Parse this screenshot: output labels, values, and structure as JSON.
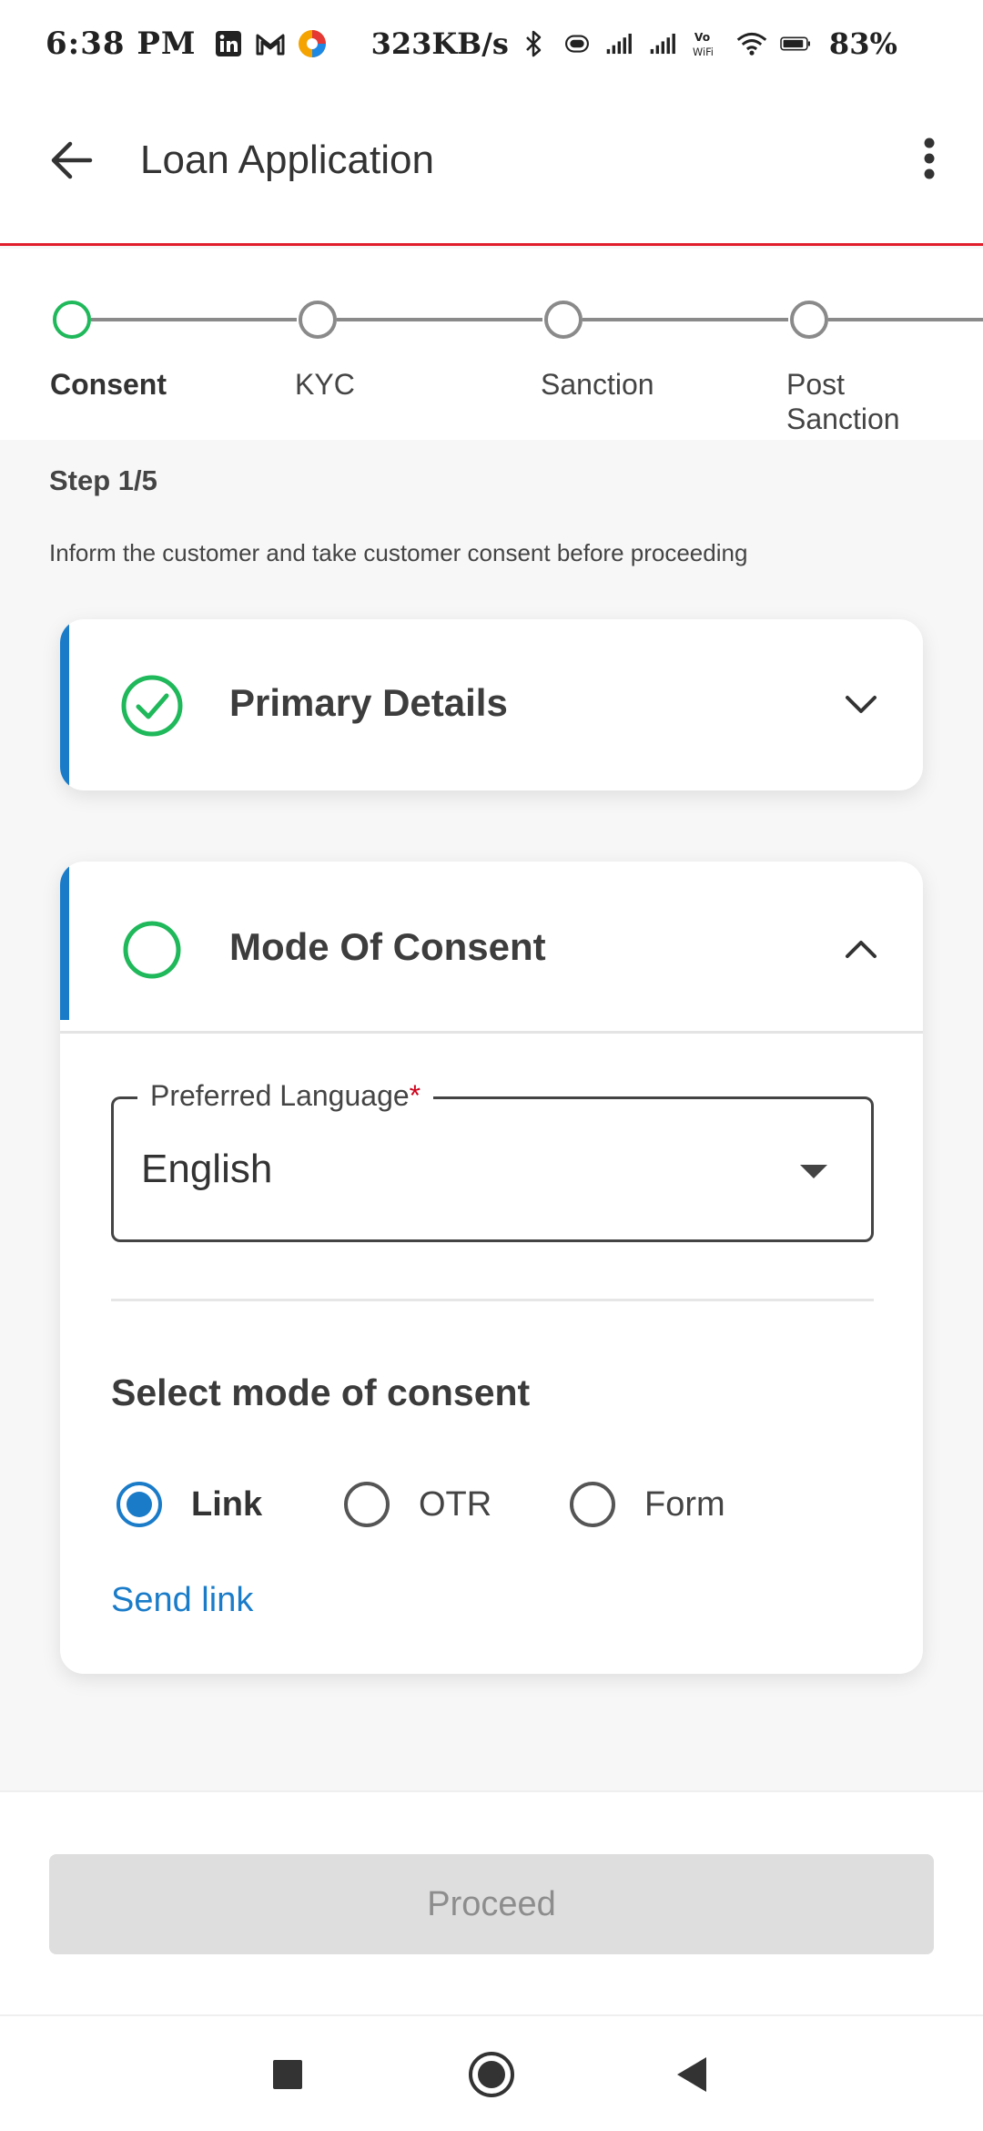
{
  "status_bar": {
    "time": "6:38 PM",
    "speed": "323KB/s",
    "battery_pct": "83%",
    "icons": [
      "linkedin-icon",
      "gmail-icon",
      "app-icon",
      "bluetooth-icon",
      "vibrate-icon",
      "signal-icon",
      "signal-icon",
      "vowifi-icon",
      "wifi-icon",
      "battery-icon"
    ]
  },
  "app_bar": {
    "title": "Loan Application",
    "back_icon": "arrow-left-icon",
    "menu_icon": "more-vert-icon"
  },
  "stepper": {
    "steps": [
      {
        "label": "Consent",
        "active": true
      },
      {
        "label": "KYC",
        "active": false
      },
      {
        "label": "Sanction",
        "active": false
      },
      {
        "label": "Post Sanction",
        "active": false
      }
    ]
  },
  "content": {
    "step_count": "Step 1/5",
    "description": "Inform the customer and take customer consent before proceeding"
  },
  "primary_details": {
    "title": "Primary Details",
    "status": "completed",
    "expanded": false
  },
  "mode_of_consent": {
    "title": "Mode Of Consent",
    "status": "pending",
    "expanded": true,
    "language_field": {
      "label": "Preferred Language",
      "required_mark": "*",
      "value": "English"
    },
    "select_title": "Select mode of consent",
    "options": [
      {
        "label": "Link",
        "selected": true
      },
      {
        "label": "OTR",
        "selected": false
      },
      {
        "label": "Form",
        "selected": false
      }
    ],
    "send_link": "Send link"
  },
  "footer": {
    "proceed_label": "Proceed",
    "proceed_enabled": false
  },
  "colors": {
    "accent_blue": "#1a7cc9",
    "success_green": "#1fb85a",
    "brand_red": "#e11d2b"
  }
}
